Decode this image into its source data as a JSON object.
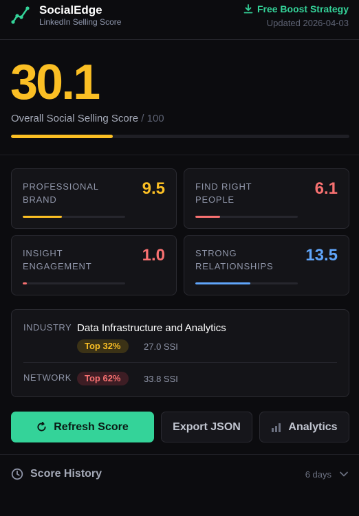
{
  "header": {
    "brand_name": "SocialEdge",
    "brand_subtitle": "LinkedIn Selling Score",
    "boost_link": "Free Boost Strategy",
    "updated": "Updated 2026-04-03"
  },
  "overall": {
    "score": "30.1",
    "caption": "Overall Social Selling Score",
    "max": "/ 100",
    "progress_fraction": 0.301
  },
  "pillars": [
    {
      "label": "PROFESSIONAL BRAND",
      "value": "9.5",
      "fraction": 0.38,
      "color": "#fbbf24"
    },
    {
      "label": "FIND RIGHT PEOPLE",
      "value": "6.1",
      "fraction": 0.244,
      "color": "#f87171"
    },
    {
      "label": "INSIGHT ENGAGEMENT",
      "value": "1.0",
      "fraction": 0.04,
      "color": "#f87171"
    },
    {
      "label": "STRONG RELATIONSHIPS",
      "value": "13.5",
      "fraction": 0.54,
      "color": "#60a5fa"
    }
  ],
  "benchmarks": {
    "industry": {
      "label": "INDUSTRY",
      "name": "Data Infrastructure and Analytics",
      "rank": "Top 32%",
      "ssi": "27.0 SSI"
    },
    "network": {
      "label": "NETWORK",
      "rank": "Top 62%",
      "ssi": "33.8 SSI"
    }
  },
  "actions": {
    "refresh": "Refresh Score",
    "export": "Export JSON",
    "analytics": "Analytics"
  },
  "history": {
    "title": "Score History",
    "range": "6 days"
  },
  "icons": {
    "logo": "chart-trend-icon",
    "boost": "download-icon",
    "refresh": "refresh-icon",
    "analytics": "bar-chart-icon",
    "history": "clock-icon",
    "chevron": "chevron-down-icon"
  },
  "colors": {
    "accent_green": "#34d399",
    "accent_amber": "#fbbf24",
    "accent_red": "#f87171",
    "accent_blue": "#60a5fa",
    "background": "#0c0c0f"
  }
}
